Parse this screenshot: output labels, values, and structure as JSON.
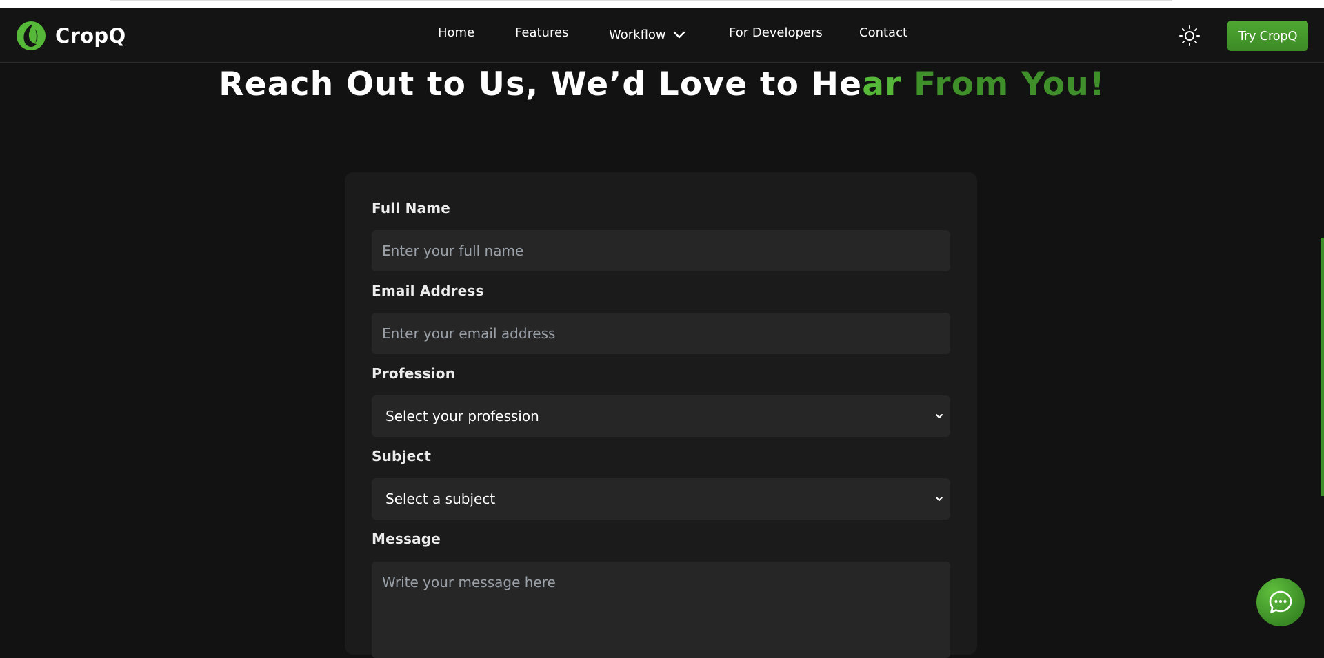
{
  "brand": {
    "name": "CropQ",
    "accent_color": "#56b839"
  },
  "nav": {
    "items": [
      {
        "label": "Home"
      },
      {
        "label": "Features"
      },
      {
        "label": "Workflow"
      },
      {
        "label": "For Developers"
      },
      {
        "label": "Contact"
      }
    ],
    "theme_toggle_icon": "sun-icon",
    "cta_label": "Try CropQ"
  },
  "hero": {
    "title_main": "Reach Out to Us, We’d Love to He",
    "title_accent_a": "ar ",
    "title_accent_b": "From You!"
  },
  "form": {
    "full_name": {
      "label": "Full Name",
      "placeholder": "Enter your full name"
    },
    "email": {
      "label": "Email Address",
      "placeholder": "Enter your email address"
    },
    "profession": {
      "label": "Profession",
      "selected": "Select your profession"
    },
    "subject": {
      "label": "Subject",
      "selected": "Select a subject"
    },
    "message": {
      "label": "Message",
      "placeholder": "Write your message here"
    }
  },
  "chat": {
    "icon": "chat-bubble-icon"
  }
}
